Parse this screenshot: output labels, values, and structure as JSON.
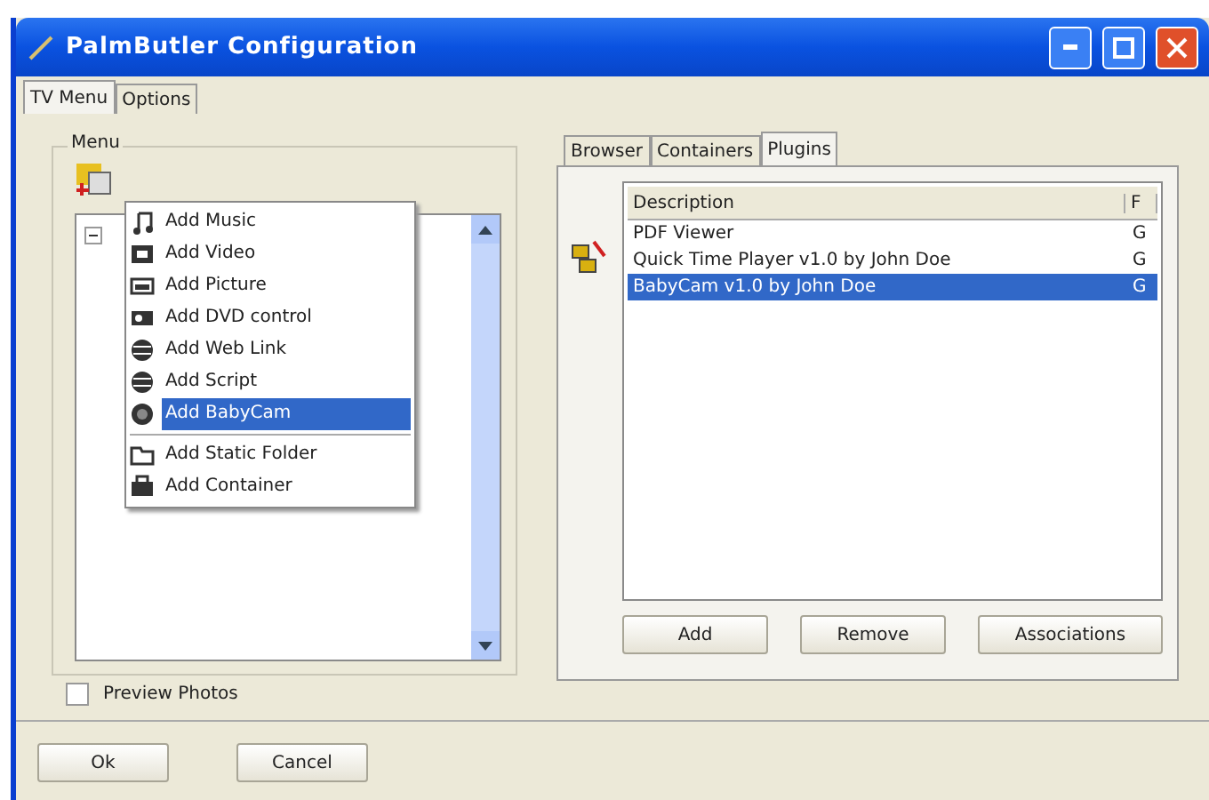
{
  "window": {
    "title": "PalmButler Configuration"
  },
  "tabs": [
    {
      "label": "TV Menu",
      "selected": true
    },
    {
      "label": "Options",
      "selected": false
    }
  ],
  "menu_group": {
    "title": "Menu",
    "preview_photos": {
      "label": "Preview Photos",
      "checked": false
    }
  },
  "context_menu": [
    {
      "label": "Add Music",
      "kind": "music",
      "selected": false
    },
    {
      "label": "Add Video",
      "kind": "video",
      "selected": false
    },
    {
      "label": "Add Picture",
      "kind": "picture",
      "selected": false
    },
    {
      "label": "Add DVD control",
      "kind": "dvd",
      "selected": false
    },
    {
      "label": "Add Web Link",
      "kind": "globe",
      "selected": false
    },
    {
      "label": "Add Script",
      "kind": "globe",
      "selected": false
    },
    {
      "label": "Add BabyCam",
      "kind": "camera",
      "selected": true
    },
    {
      "label": "Add Static Folder",
      "kind": "folder",
      "selected": false,
      "separator_before": true
    },
    {
      "label": "Add Container",
      "kind": "container",
      "selected": false
    }
  ],
  "right_tabs": [
    {
      "label": "Browser",
      "selected": false
    },
    {
      "label": "Containers",
      "selected": false
    },
    {
      "label": "Plugins",
      "selected": true
    }
  ],
  "plugins_table": {
    "columns": [
      "Description",
      "F"
    ],
    "rows": [
      {
        "cells": [
          "PDF Viewer",
          "G"
        ],
        "selected": false
      },
      {
        "cells": [
          "Quick Time Player v1.0 by John Doe",
          "G"
        ],
        "selected": false
      },
      {
        "cells": [
          "BabyCam v1.0 by John Doe",
          "G"
        ],
        "selected": true
      }
    ]
  },
  "plugin_buttons": [
    "Add",
    "Remove",
    "Associations"
  ],
  "dialog_buttons": [
    "Ok",
    "Cancel"
  ]
}
